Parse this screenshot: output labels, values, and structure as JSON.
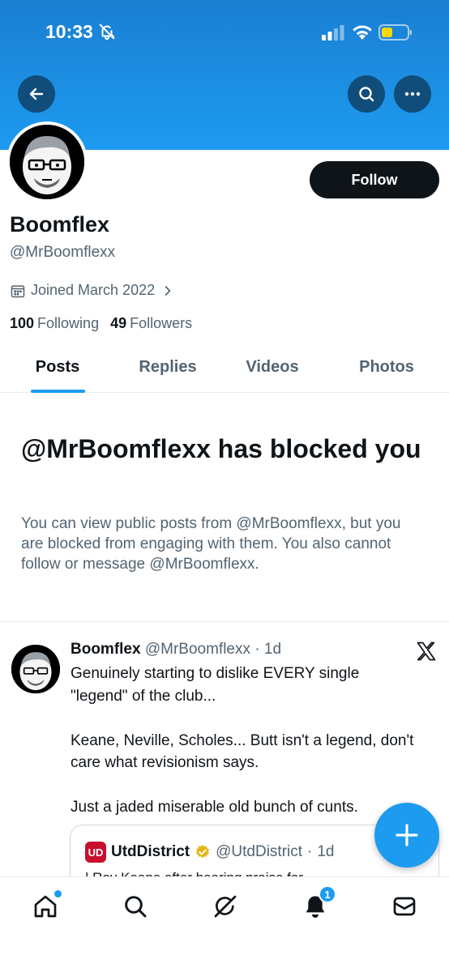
{
  "status_bar": {
    "time": "10:33"
  },
  "profile": {
    "display_name": "Boomflex",
    "handle": "@MrBoomflexx",
    "joined": "Joined March 2022",
    "following_count": "100",
    "following_label": "Following",
    "followers_count": "49",
    "followers_label": "Followers",
    "follow_label": "Follow"
  },
  "tabs": [
    {
      "label": "Posts",
      "active": true
    },
    {
      "label": "Replies",
      "active": false
    },
    {
      "label": "Videos",
      "active": false
    },
    {
      "label": "Photos",
      "active": false
    }
  ],
  "blocked": {
    "title": "@MrBoomflexx has blocked you",
    "description": "You can view public posts from @MrBoomflexx, but you are blocked from engaging with them. You also cannot follow or message @MrBoomflexx."
  },
  "post": {
    "name": "Boomflex",
    "handle": "@MrBoomflexx",
    "time": "1d",
    "lines": [
      "Genuinely starting to dislike EVERY single \"legend\" of the club...",
      "",
      "Keane, Neville, Scholes... Butt isn't a legend, don't care what revisionism says.",
      "",
      "Just a jaded miserable old bunch of cunts."
    ],
    "quote": {
      "logo_text": "UD",
      "name": "UtdDistrict",
      "handle": "@UtdDistrict",
      "time": "1d",
      "snippet": "| Roy Keane after hearing praise for"
    }
  },
  "bottom_nav": {
    "notifications_badge": "1",
    "items": [
      "home-icon",
      "search-icon",
      "grok-icon",
      "notifications-icon",
      "messages-icon"
    ]
  },
  "colors": {
    "accent": "#1d9bf0",
    "text": "#0f1419",
    "secondary": "#536471",
    "brand_red": "#c8102e"
  }
}
